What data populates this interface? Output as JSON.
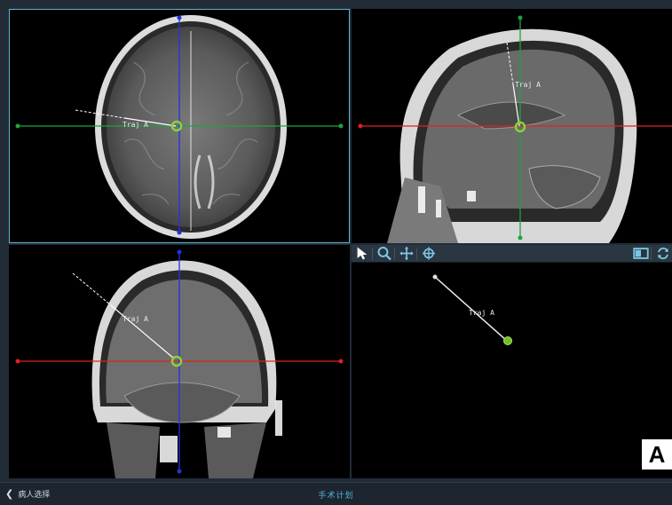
{
  "viewports": {
    "axial": {
      "traj_label": "Traj A"
    },
    "sagittal": {
      "traj_label": "Traj A"
    },
    "coronal": {
      "traj_label": "Traj A"
    },
    "view3d": {
      "traj_label": "Traj A"
    }
  },
  "toolbar": {
    "left_icons": [
      "pointer-icon",
      "zoom-icon",
      "pan-icon",
      "rotate-icon"
    ],
    "right_icons": [
      "layout-icon",
      "reset-icon"
    ]
  },
  "panel_label": "A",
  "bottom_bar": {
    "back_label": "病人选择",
    "title": "手术计划"
  },
  "colors": {
    "accent": "#4fb5d6",
    "crosshair_red": "#e02020",
    "crosshair_green": "#1fa33a",
    "crosshair_blue": "#2233dd",
    "target_green": "#8fcf3a"
  }
}
